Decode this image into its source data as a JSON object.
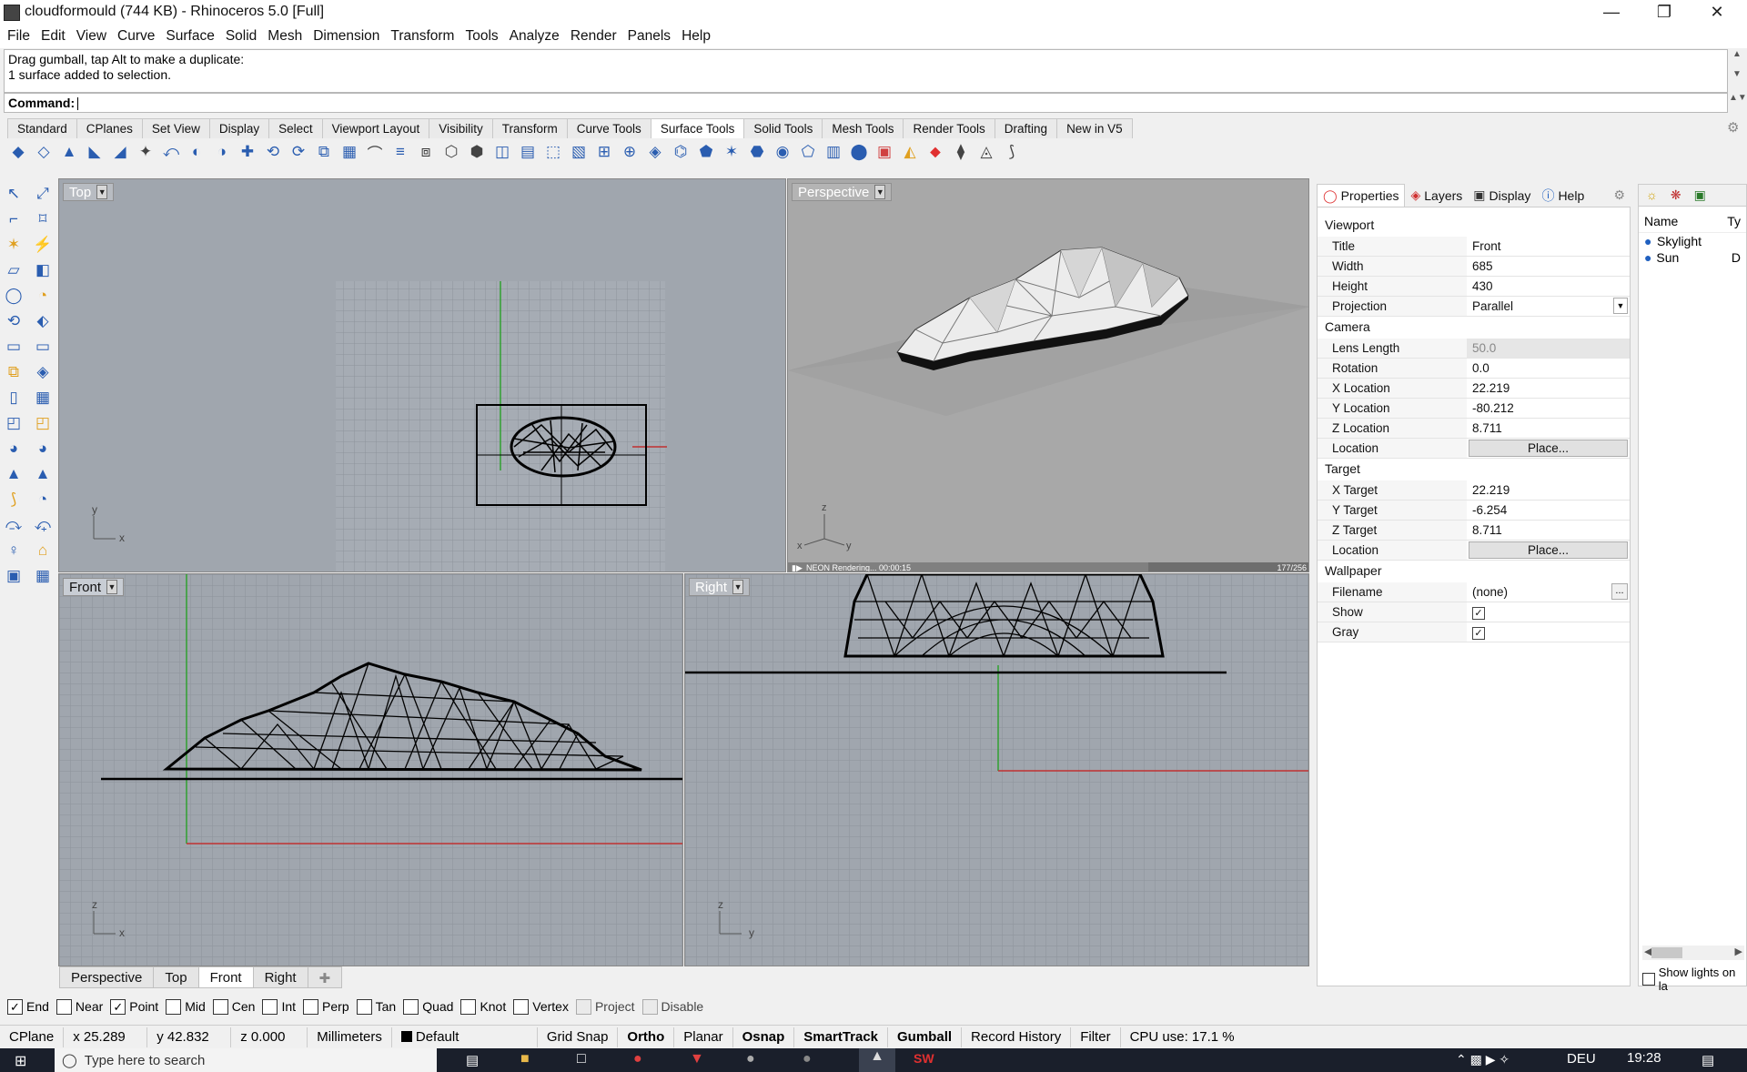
{
  "window": {
    "title": "cloudformould (744 KB) - Rhinoceros 5.0 [Full]"
  },
  "menu": [
    "File",
    "Edit",
    "View",
    "Curve",
    "Surface",
    "Solid",
    "Mesh",
    "Dimension",
    "Transform",
    "Tools",
    "Analyze",
    "Render",
    "Panels",
    "Help"
  ],
  "history": [
    "Drag gumball, tap Alt to make a duplicate:",
    "1 surface added to selection."
  ],
  "command": {
    "label": "Command:"
  },
  "toolbar_tabs": [
    {
      "label": "Standard"
    },
    {
      "label": "CPlanes"
    },
    {
      "label": "Set View"
    },
    {
      "label": "Display"
    },
    {
      "label": "Select"
    },
    {
      "label": "Viewport Layout"
    },
    {
      "label": "Visibility"
    },
    {
      "label": "Transform"
    },
    {
      "label": "Curve Tools"
    },
    {
      "label": "Surface Tools",
      "active": true
    },
    {
      "label": "Solid Tools"
    },
    {
      "label": "Mesh Tools"
    },
    {
      "label": "Render Tools"
    },
    {
      "label": "Drafting"
    },
    {
      "label": "New in V5"
    }
  ],
  "viewports": {
    "top": {
      "title": "Top"
    },
    "perspective": {
      "title": "Perspective",
      "render_status": "NEON Rendering... 00:00:15",
      "render_progress": "177/256"
    },
    "front": {
      "title": "Front"
    },
    "right": {
      "title": "Right"
    }
  },
  "axis_labels": {
    "x": "x",
    "y": "y",
    "z": "z"
  },
  "viewport_tabs": [
    {
      "label": "Perspective"
    },
    {
      "label": "Top"
    },
    {
      "label": "Front",
      "active": true
    },
    {
      "label": "Right"
    }
  ],
  "osnap": [
    {
      "label": "End",
      "checked": true
    },
    {
      "label": "Near",
      "checked": false
    },
    {
      "label": "Point",
      "checked": true
    },
    {
      "label": "Mid",
      "checked": false
    },
    {
      "label": "Cen",
      "checked": false
    },
    {
      "label": "Int",
      "checked": false
    },
    {
      "label": "Perp",
      "checked": false
    },
    {
      "label": "Tan",
      "checked": false
    },
    {
      "label": "Quad",
      "checked": false
    },
    {
      "label": "Knot",
      "checked": false
    },
    {
      "label": "Vertex",
      "checked": false
    },
    {
      "label": "Project",
      "checked": false,
      "disabled": true
    },
    {
      "label": "Disable",
      "checked": false,
      "disabled": true
    }
  ],
  "status": {
    "cplane": "CPlane",
    "x": "x 25.289",
    "y": "y 42.832",
    "z": "z 0.000",
    "units": "Millimeters",
    "layer": "Default",
    "grid_snap": "Grid Snap",
    "ortho": "Ortho",
    "planar": "Planar",
    "osnap": "Osnap",
    "smarttrack": "SmartTrack",
    "gumball": "Gumball",
    "record_history": "Record History",
    "filter": "Filter",
    "cpu": "CPU use: 17.1 %"
  },
  "panel": {
    "tabs": [
      "Properties",
      "Layers",
      "Display",
      "Help"
    ],
    "sections": {
      "viewport": "Viewport",
      "camera": "Camera",
      "target": "Target",
      "wallpaper": "Wallpaper"
    },
    "viewport": [
      {
        "k": "Title",
        "v": "Front"
      },
      {
        "k": "Width",
        "v": "685"
      },
      {
        "k": "Height",
        "v": "430"
      },
      {
        "k": "Projection",
        "v": "Parallel"
      }
    ],
    "camera": [
      {
        "k": "Lens Length",
        "v": "50.0"
      },
      {
        "k": "Rotation",
        "v": "0.0"
      },
      {
        "k": "X Location",
        "v": "22.219"
      },
      {
        "k": "Y Location",
        "v": "-80.212"
      },
      {
        "k": "Z Location",
        "v": "8.711"
      },
      {
        "k": "Location",
        "v": "Place..."
      }
    ],
    "target": [
      {
        "k": "X Target",
        "v": "22.219"
      },
      {
        "k": "Y Target",
        "v": "-6.254"
      },
      {
        "k": "Z Target",
        "v": "8.711"
      },
      {
        "k": "Location",
        "v": "Place..."
      }
    ],
    "wallpaper": [
      {
        "k": "Filename",
        "v": "(none)"
      },
      {
        "k": "Show",
        "v": ""
      },
      {
        "k": "Gray",
        "v": ""
      }
    ]
  },
  "lights": {
    "header": "Name",
    "header2": "Ty",
    "items": [
      {
        "name": "Skylight"
      },
      {
        "name": "Sun",
        "type": "D"
      }
    ],
    "show_lights": "Show lights on la"
  },
  "taskbar": {
    "search_placeholder": "Type here to search",
    "lang": "DEU",
    "time": "19:28"
  },
  "colors": {
    "viewport_bg": "#a0a6ae",
    "perspective_bg": "#a8a8a8",
    "x_axis": "#c03030",
    "y_axis": "#30a030"
  }
}
